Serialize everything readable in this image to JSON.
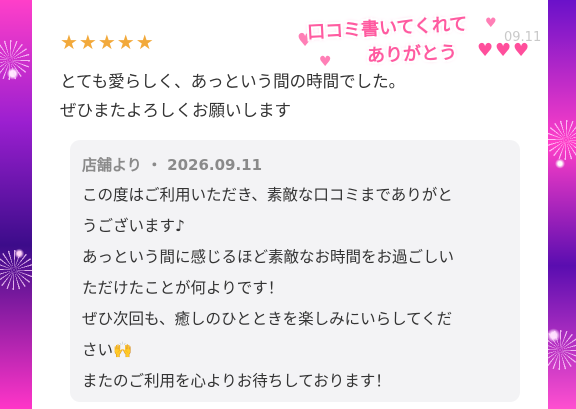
{
  "review": {
    "rating_stars": "★★★★★",
    "date_partial": "09.11",
    "lines": [
      "とても愛らしく、あっという間の時間でした。",
      "ぜひまたよろしくお願いします"
    ]
  },
  "reply": {
    "header": "店舗より ・ 2026.09.11",
    "lines": [
      "この度はご利用いただき、素敵な口コミまでありがと",
      "うございます♪",
      "あっという間に感じるほど素敵なお時間をお過ごしい",
      "ただけたことが何よりです！",
      "ぜひ次回も、癒しのひとときを楽しみにいらしてくだ",
      "さい🙌",
      "またのご利用を心よりお待ちしております！"
    ]
  },
  "sticker": {
    "line1": "口コミ書いてくれて",
    "line2": "ありがとう"
  },
  "colors": {
    "star": "#f2a93b",
    "sticker_pink": "#ff5aa0",
    "reply_bg": "#f3f3f5"
  }
}
